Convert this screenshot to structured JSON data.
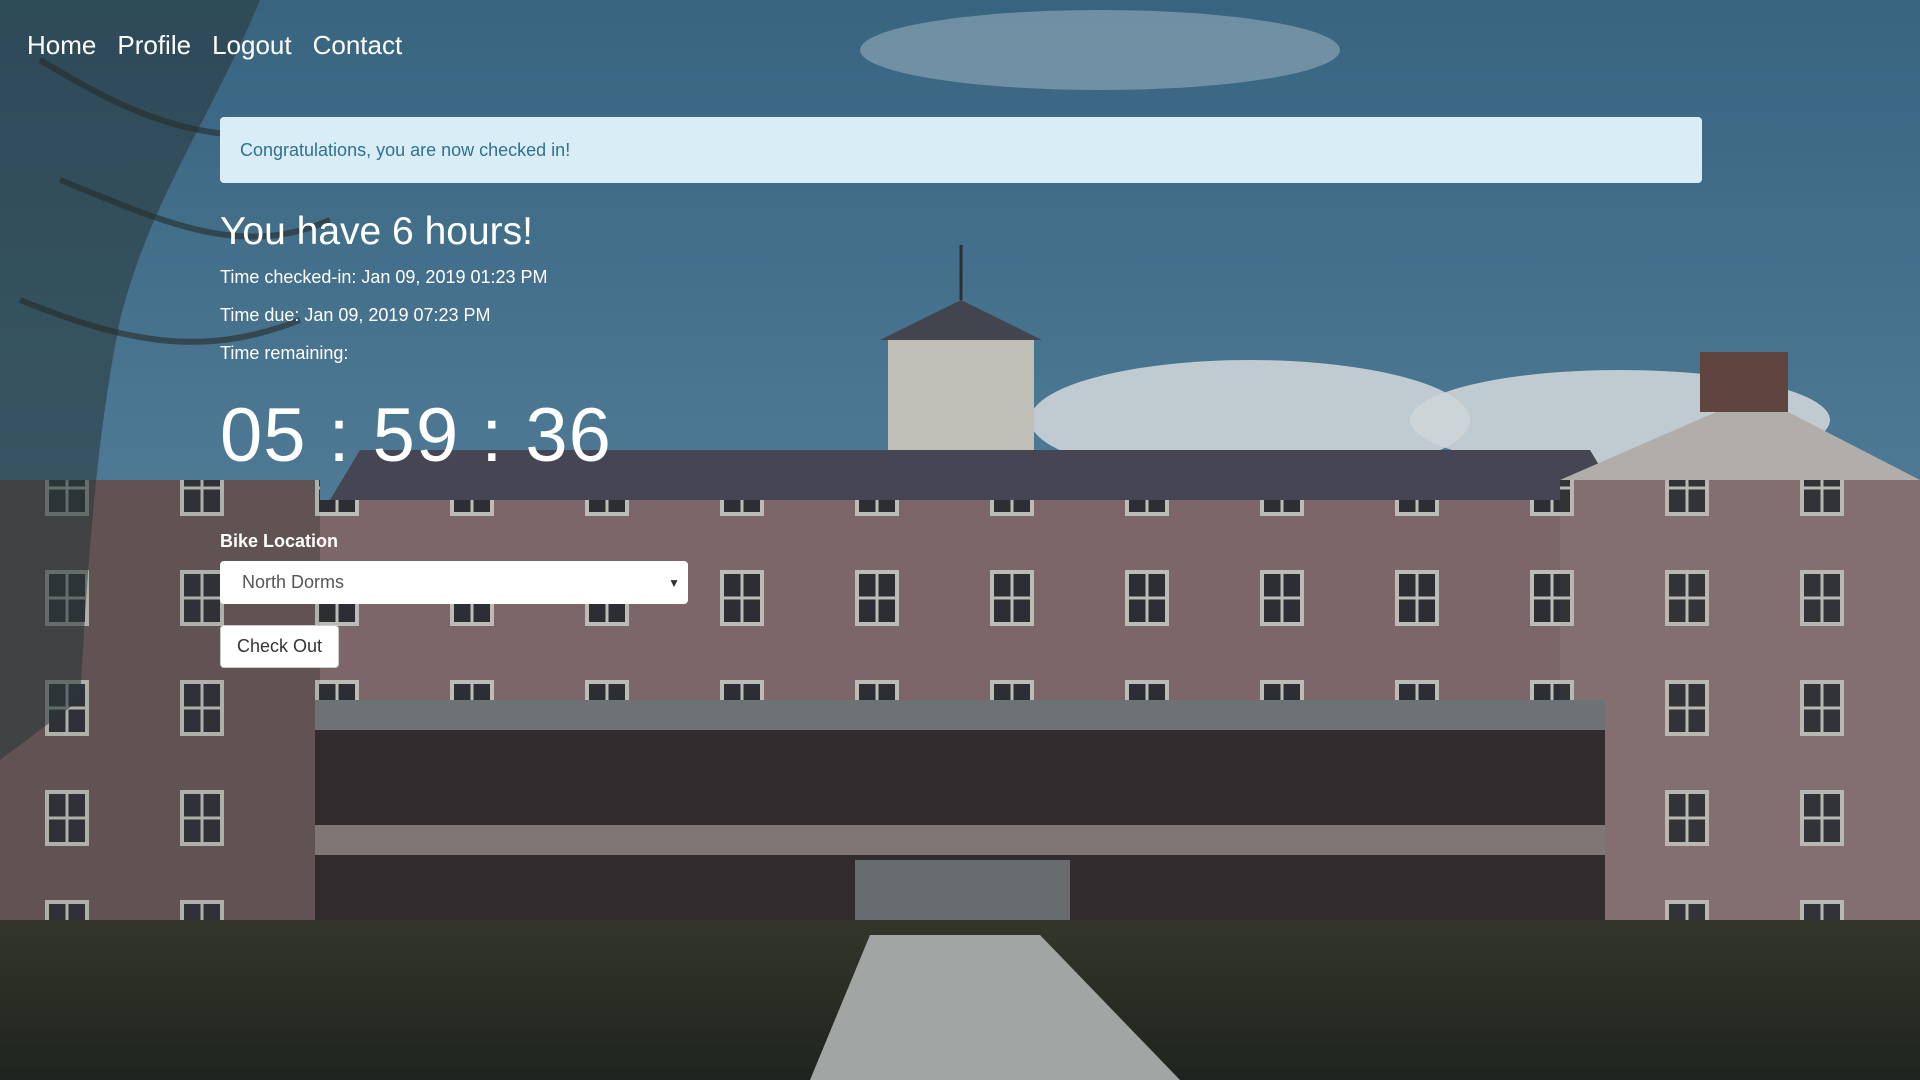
{
  "nav": {
    "items": [
      {
        "label": "Home"
      },
      {
        "label": "Profile"
      },
      {
        "label": "Logout"
      },
      {
        "label": "Contact"
      }
    ]
  },
  "alert": {
    "message": "Congratulations, you are now checked in!"
  },
  "status": {
    "headline": "You have 6 hours!",
    "checked_in": "Time checked-in: Jan 09, 2019 01:23 PM",
    "due": "Time due: Jan 09, 2019 07:23 PM",
    "remaining_label": "Time remaining:"
  },
  "timer": {
    "hours": "05",
    "minutes": "59",
    "seconds": "36",
    "separator": ":"
  },
  "form": {
    "location_label": "Bike Location",
    "location_value": "North Dorms",
    "submit_label": "Check Out"
  },
  "colors": {
    "alert_bg": "#d9edf7",
    "alert_text": "#31708f",
    "sky": "#4a7b97",
    "building": "#8a6e70"
  }
}
